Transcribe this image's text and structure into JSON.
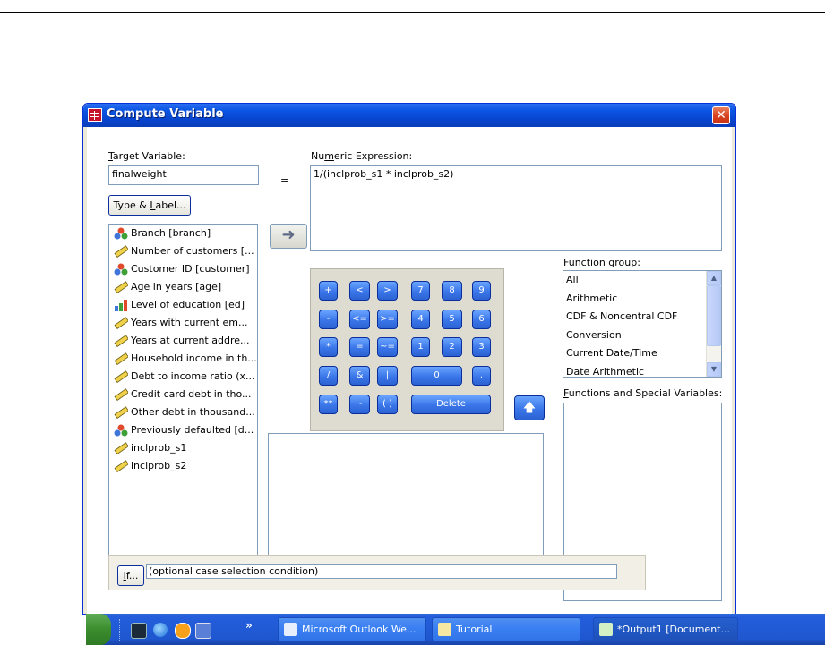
{
  "dialog": {
    "title": "Compute Variable",
    "close_label": "✕"
  },
  "target": {
    "label_pre": "T",
    "label_rest": "arget Variable:",
    "value": "finalweight",
    "equals": "="
  },
  "type_label_button": {
    "pre": "Type & ",
    "u": "L",
    "post": "abel..."
  },
  "numeric": {
    "label_pre": "Nu",
    "label_u": "m",
    "label_post": "eric Expression:",
    "value": "1/(inclprob_s1 * inclprob_s2)"
  },
  "variables": [
    {
      "label": "Branch [branch]",
      "icon": "nominal-icon"
    },
    {
      "label": "Number of customers [...",
      "icon": "scale-icon"
    },
    {
      "label": "Customer ID [customer]",
      "icon": "nominal-icon"
    },
    {
      "label": "Age in years [age]",
      "icon": "scale-icon"
    },
    {
      "label": "Level of education [ed]",
      "icon": "ordinal-icon"
    },
    {
      "label": "Years with current em...",
      "icon": "scale-icon"
    },
    {
      "label": "Years at current addre...",
      "icon": "scale-icon"
    },
    {
      "label": "Household income in th...",
      "icon": "scale-icon"
    },
    {
      "label": "Debt to income ratio (x...",
      "icon": "scale-icon"
    },
    {
      "label": "Credit card debt in tho...",
      "icon": "scale-icon"
    },
    {
      "label": "Other debt in thousand...",
      "icon": "scale-icon"
    },
    {
      "label": "Previously defaulted [d...",
      "icon": "nominal-icon"
    },
    {
      "label": "inclprob_s1",
      "icon": "scale-icon"
    },
    {
      "label": "inclprob_s2",
      "icon": "scale-icon"
    }
  ],
  "keypad": {
    "plus": "+",
    "less": "<",
    "greater": ">",
    "k7": "7",
    "k8": "8",
    "k9": "9",
    "minus": "-",
    "le": "<=",
    "ge": ">=",
    "k4": "4",
    "k5": "5",
    "k6": "6",
    "times": "*",
    "eq": "=",
    "ne": "~=",
    "k1": "1",
    "k2": "2",
    "k3": "3",
    "divide": "/",
    "and": "&",
    "or": "|",
    "k0": "0",
    "dot": ".",
    "power": "**",
    "not": "~",
    "paren": "( )",
    "delete": "Delete"
  },
  "function_group": {
    "label_pre": "Function ",
    "label_u": "g",
    "label_post": "roup:",
    "items": [
      "All",
      "Arithmetic",
      "CDF & Noncentral CDF",
      "Conversion",
      "Current Date/Time",
      "Date Arithmetic"
    ]
  },
  "functions_special": {
    "label_pre": "",
    "label_u": "F",
    "label_post": "unctions and Special Variables:"
  },
  "if_section": {
    "button_u": "I",
    "button_post": "f...",
    "condition": "(optional case selection condition)"
  },
  "taskbar": {
    "overflow": "»",
    "windows": [
      {
        "label": "Microsoft Outlook We..."
      },
      {
        "label": "Tutorial"
      },
      {
        "label": "*Output1 [Document..."
      }
    ]
  }
}
